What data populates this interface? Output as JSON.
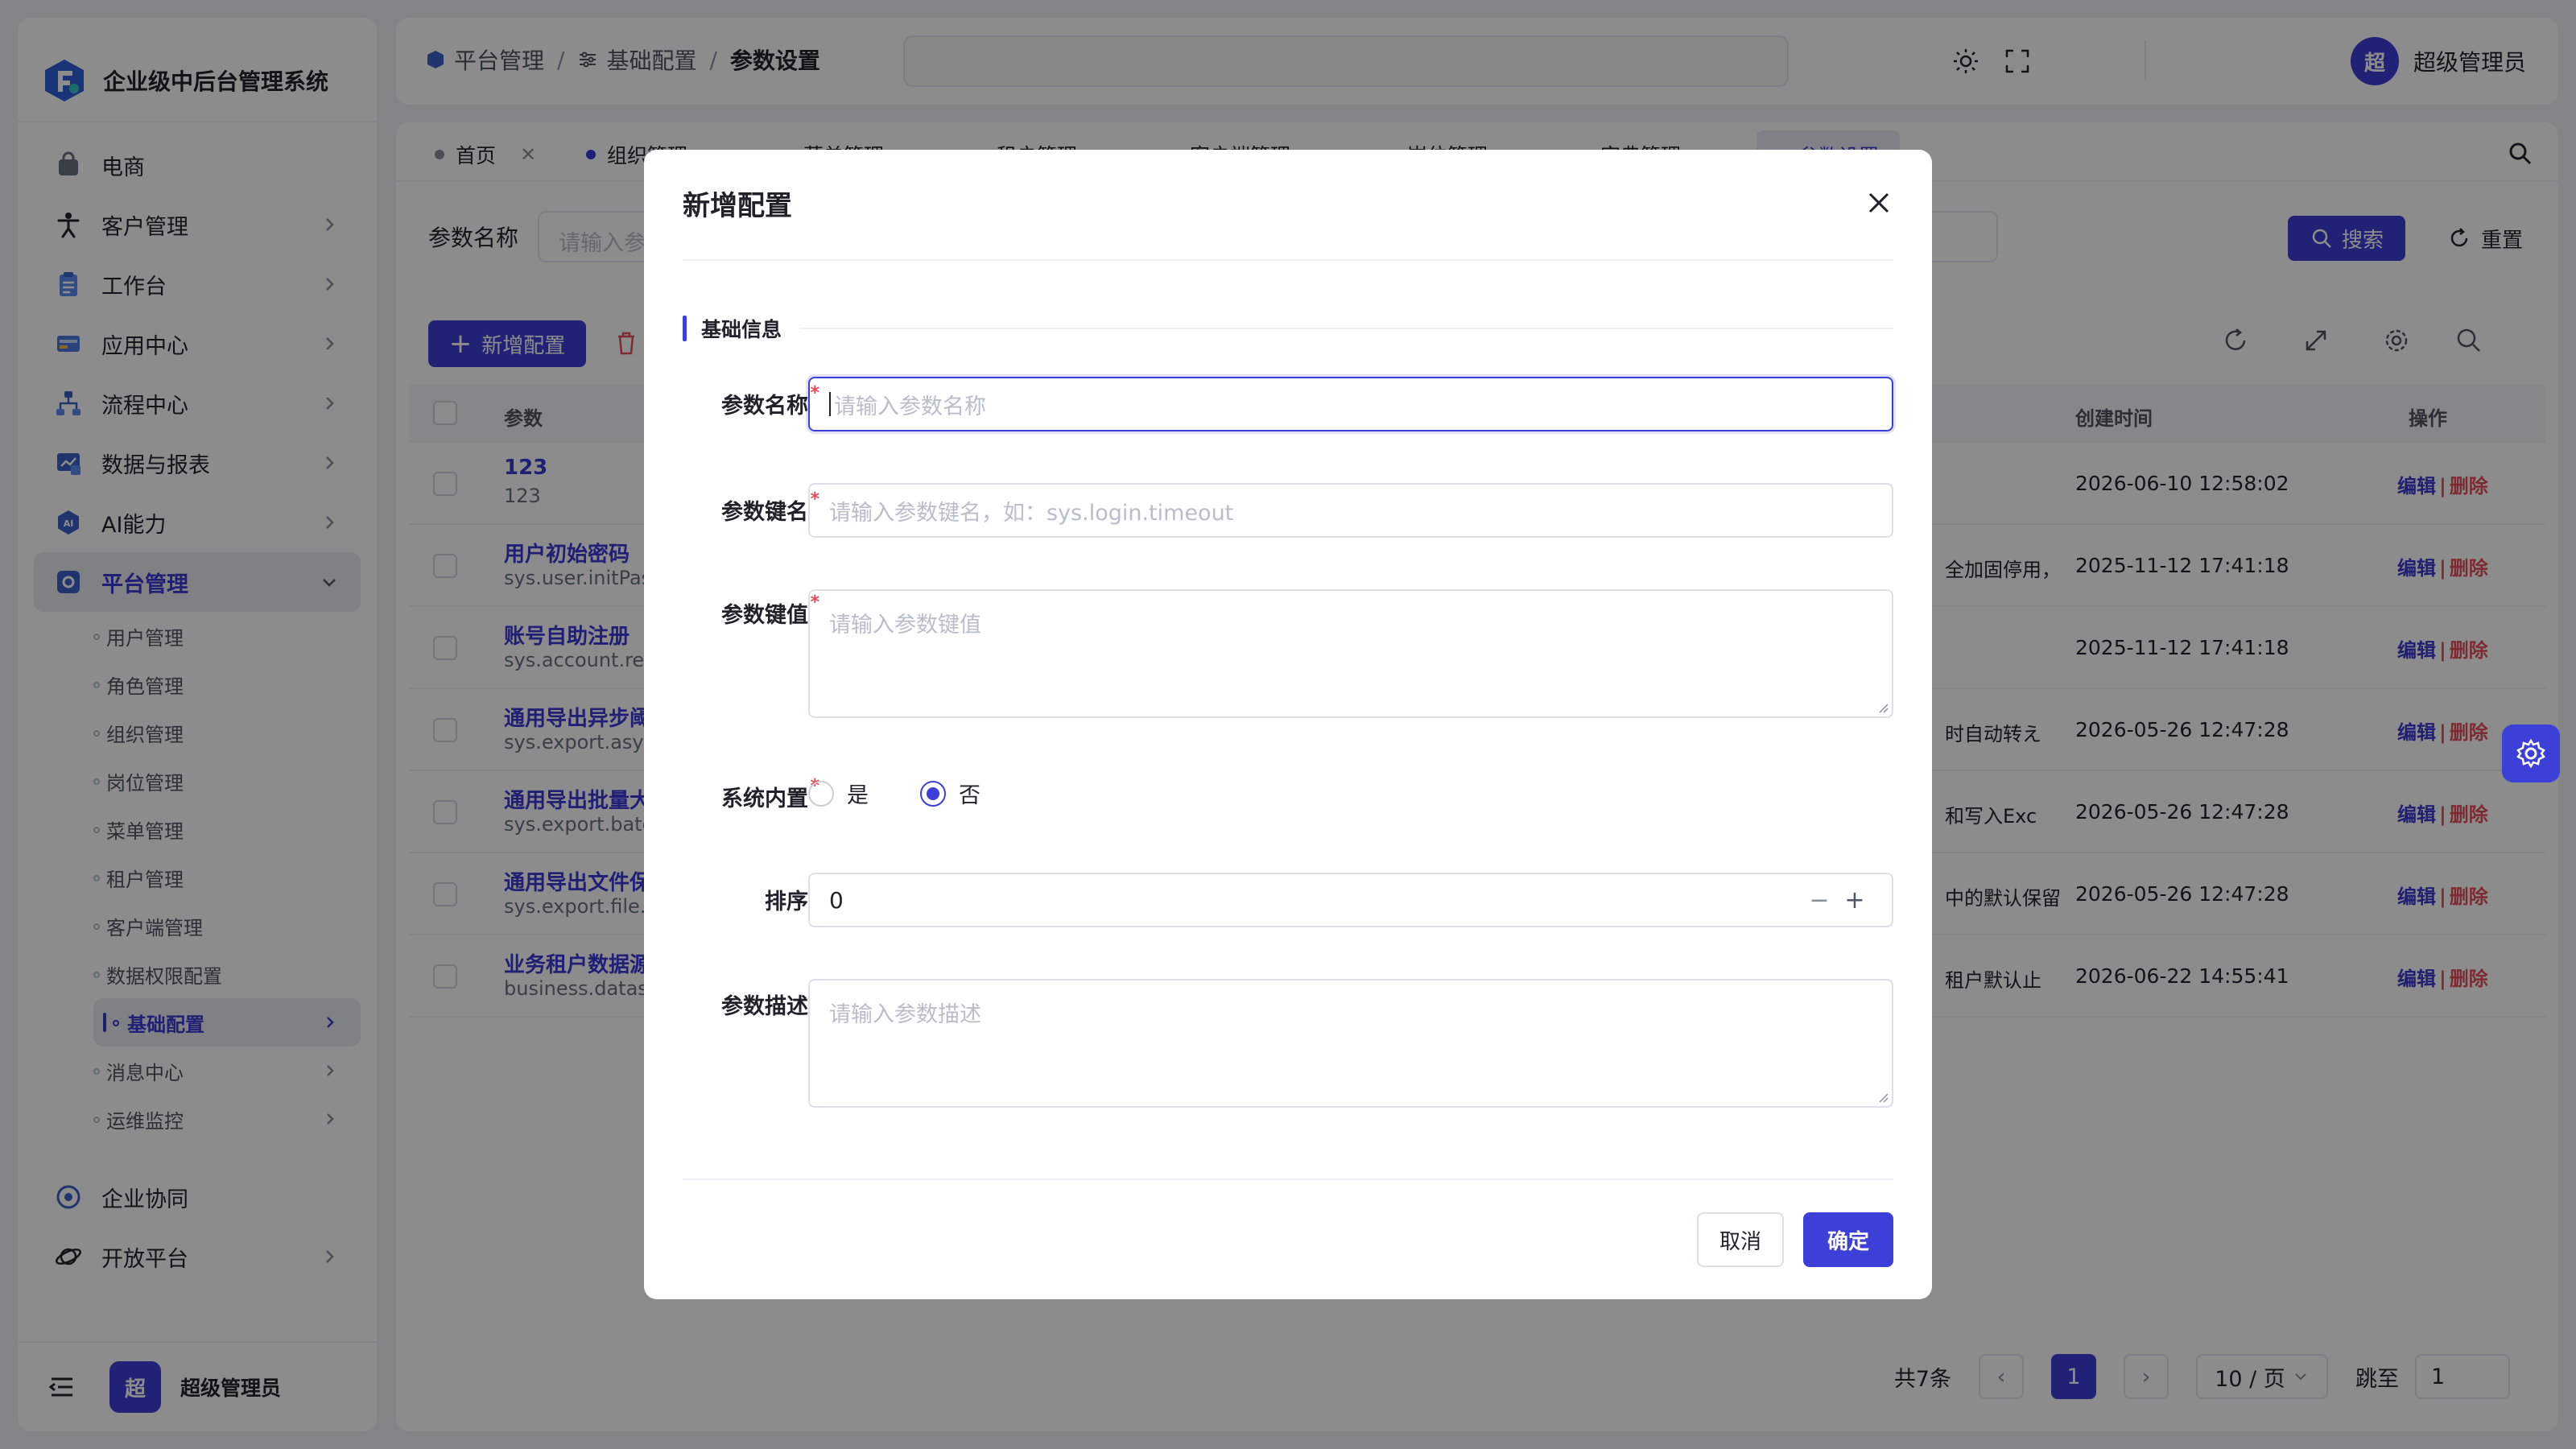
{
  "app": {
    "title": "企业级中后台管理系统",
    "user": "超级管理员",
    "avatar_char": "超"
  },
  "sidebar": {
    "items": [
      {
        "label": "电商",
        "icon": "bag-icon"
      },
      {
        "label": "客户管理",
        "icon": "person-icon"
      },
      {
        "label": "工作台",
        "icon": "clipboard-icon"
      },
      {
        "label": "应用中心",
        "icon": "apps-icon"
      },
      {
        "label": "流程中心",
        "icon": "flow-icon"
      },
      {
        "label": "数据与报表",
        "icon": "chart-icon"
      },
      {
        "label": "AI能力",
        "icon": "ai-icon"
      },
      {
        "label": "平台管理",
        "icon": "platform-icon"
      }
    ],
    "sub_items": [
      "用户管理",
      "角色管理",
      "组织管理",
      "岗位管理",
      "菜单管理",
      "租户管理",
      "客户端管理",
      "数据权限配置",
      "基础配置",
      "消息中心",
      "运维监控"
    ],
    "bottom_items": [
      {
        "label": "企业协同",
        "icon": "collab-icon"
      },
      {
        "label": "开放平台",
        "icon": "planet-icon"
      }
    ]
  },
  "header": {
    "breadcrumb": [
      "平台管理",
      "基础配置",
      "参数设置"
    ]
  },
  "tabs": [
    "首页",
    "组织管理",
    "菜单管理",
    "租户管理",
    "客户端管理",
    "岗位管理",
    "字典管理",
    "参数设置"
  ],
  "filter": {
    "label": "参数名称",
    "placeholder": "请输入参",
    "search": "搜索",
    "reset": "重置"
  },
  "toolbar": {
    "add": "新增配置"
  },
  "table": {
    "headers": {
      "name": "参数",
      "created": "创建时间",
      "ops": "操作"
    },
    "rows": [
      {
        "name": "123",
        "key": "123",
        "desc": "",
        "time": "2026-06-10 12:58:02"
      },
      {
        "name": "用户初始密码",
        "key": "sys.user.initPas",
        "desc": "全加固停用，",
        "time": "2025-11-12 17:41:18"
      },
      {
        "name": "账号自助注册",
        "key": "sys.account.reg",
        "desc": "",
        "time": "2025-11-12 17:41:18"
      },
      {
        "name": "通用导出异步阈",
        "key": "sys.export.asyn",
        "desc": "时自动转え",
        "time": "2026-05-26 12:47:28"
      },
      {
        "name": "通用导出批量大",
        "key": "sys.export.batcl",
        "desc": "和写入Exc",
        "time": "2026-05-26 12:47:28"
      },
      {
        "name": "通用导出文件保",
        "key": "sys.export.file.k",
        "desc": "中的默认保留",
        "time": "2026-05-26 12:47:28"
      },
      {
        "name": "业务租户数据源",
        "key": "business.datasc",
        "desc": "租户默认止",
        "time": "2026-06-22 14:55:41"
      }
    ],
    "op_edit": "编辑",
    "op_sep": "|",
    "op_delete": "删除"
  },
  "pager": {
    "total": "共7条",
    "page": "1",
    "size": "10 / 页",
    "jump_label": "跳至",
    "jump_value": "1"
  },
  "modal": {
    "title": "新增配置",
    "section": "基础信息",
    "fields": {
      "name_label": "参数名称",
      "name_placeholder": "请输入参数名称",
      "key_label": "参数键名",
      "key_placeholder": "请输入参数键名，如：sys.login.timeout",
      "value_label": "参数键值",
      "value_placeholder": "请输入参数键值",
      "builtin_label": "系统内置",
      "builtin_yes": "是",
      "builtin_no": "否",
      "sort_label": "排序",
      "sort_value": "0",
      "desc_label": "参数描述",
      "desc_placeholder": "请输入参数描述"
    },
    "required_mark": "*",
    "cancel": "取消",
    "ok": "确定"
  },
  "colors": {
    "primary": "#3c3fd8",
    "danger": "#e34d59"
  }
}
